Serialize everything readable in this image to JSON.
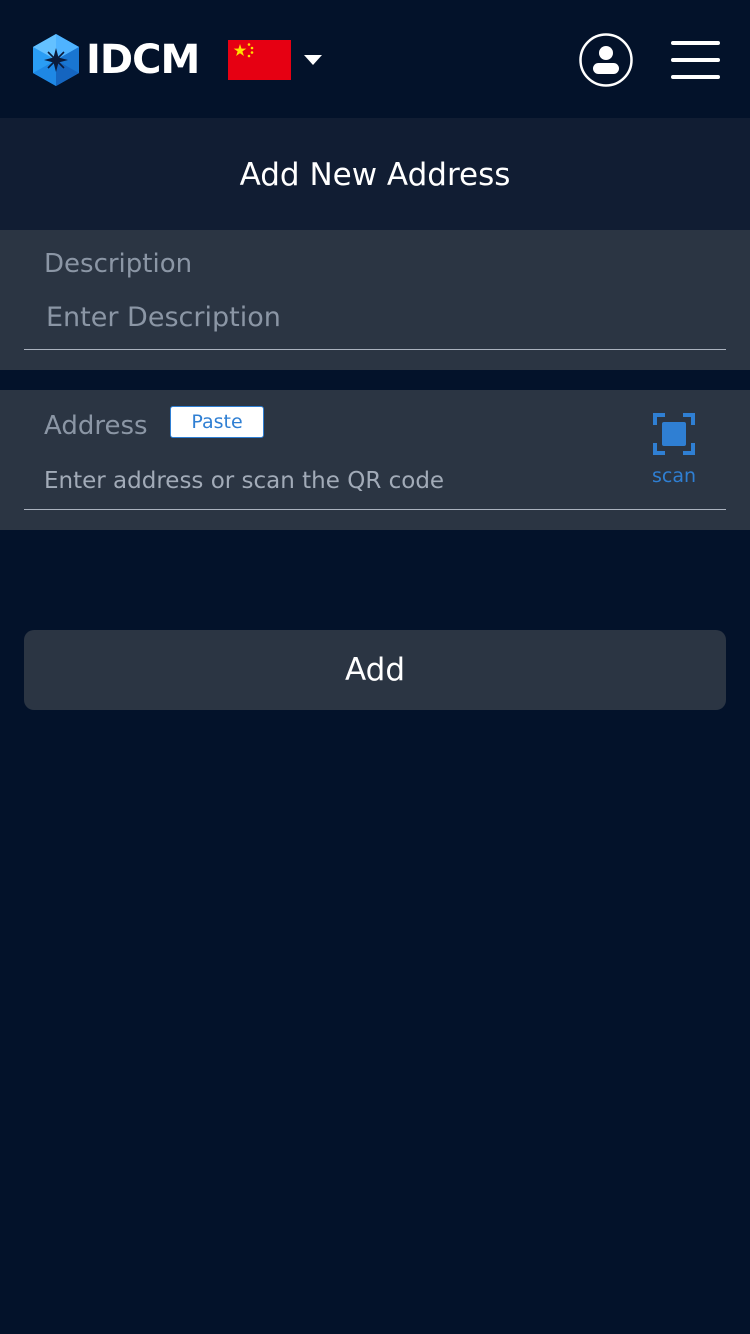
{
  "header": {
    "brand": "IDCM",
    "logo_icon": "idcm-hexagon-logo",
    "language_flag": "china-flag",
    "language_caret_icon": "caret-down-icon",
    "user_icon": "user-circle-icon",
    "menu_icon": "hamburger-menu-icon"
  },
  "page": {
    "title": "Add New Address"
  },
  "description": {
    "label": "Description",
    "placeholder": "Enter Description",
    "value": ""
  },
  "address": {
    "label": "Address",
    "paste_label": "Paste",
    "placeholder": "Enter address or scan the QR code",
    "value": "",
    "scan_label": "scan",
    "scan_icon": "qr-scan-icon"
  },
  "actions": {
    "add_label": "Add"
  },
  "colors": {
    "background": "#03122a",
    "title_band": "#111d33",
    "panel": "#2b3543",
    "accent": "#2f7fd3",
    "muted_text": "#8b96a5",
    "flag_red": "#e60012",
    "flag_star": "#ffde00"
  }
}
